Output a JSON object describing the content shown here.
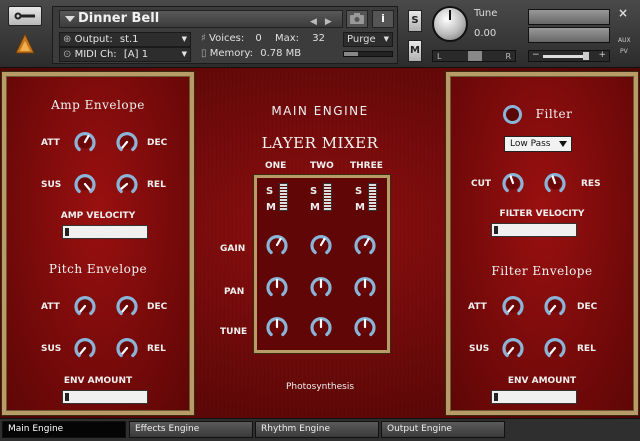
{
  "header": {
    "instrument_name": "Dinner Bell",
    "output_label": "Output:",
    "output_value": "st.1",
    "midi_label": "MIDI Ch:",
    "midi_value": "[A]  1",
    "voices_label": "Voices:",
    "voices_value": "0",
    "max_label": "Max:",
    "max_value": "32",
    "memory_label": "Memory:",
    "memory_value": "0.78 MB",
    "purge_label": "Purge",
    "info_label": "i",
    "solo_label": "S",
    "mute_label": "M",
    "tune_label": "Tune",
    "tune_value": "0.00",
    "pan_left": "L",
    "pan_right": "R",
    "vol_minus": "−",
    "vol_plus": "+",
    "close_label": "×",
    "aux_label": "AUX",
    "pv_label": "PV"
  },
  "left_panel": {
    "amp_title": "Amp Envelope",
    "amp_att": "ATT",
    "amp_dec": "DEC",
    "amp_sus": "SUS",
    "amp_rel": "REL",
    "amp_velocity": "AMP VELOCITY",
    "pitch_title": "Pitch Envelope",
    "pitch_att": "ATT",
    "pitch_dec": "DEC",
    "pitch_sus": "SUS",
    "pitch_rel": "REL",
    "env_amount": "ENV AMOUNT"
  },
  "center": {
    "main_engine": "MAIN ENGINE",
    "layer_mixer": "LAYER MIXER",
    "columns": [
      "ONE",
      "TWO",
      "THREE"
    ],
    "solo": "S",
    "mute": "M",
    "rows": [
      "GAIN",
      "PAN",
      "TUNE"
    ],
    "preset_name": "Photosynthesis"
  },
  "right_panel": {
    "filter_title": "Filter",
    "filter_type": "Low Pass",
    "cut": "CUT",
    "res": "RES",
    "filter_velocity": "FILTER VELOCITY",
    "filter_env_title": "Filter Envelope",
    "att": "ATT",
    "dec": "DEC",
    "sus": "SUS",
    "rel": "REL",
    "env_amount": "ENV AMOUNT"
  },
  "tabs": [
    "Main Engine",
    "Effects Engine",
    "Rhythm Engine",
    "Output Engine"
  ],
  "colors": {
    "panel_red": "#8a0c0c",
    "frame_gold": "#b79c67",
    "knob_blue": "#8ab5d8"
  }
}
